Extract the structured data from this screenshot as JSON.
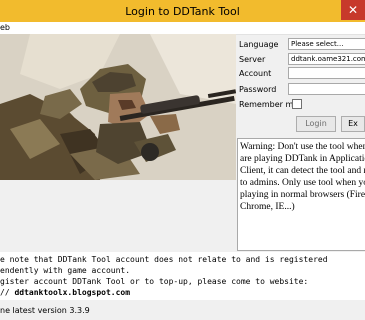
{
  "window": {
    "title": "Login to DDTank Tool",
    "close_glyph": "✕"
  },
  "menu": {
    "item": "eb"
  },
  "form": {
    "language_label": "Language",
    "language_value": "Please select...",
    "server_label": "Server",
    "server_value": "ddtank.oame321.com",
    "account_label": "Account",
    "account_value": "",
    "password_label": "Password",
    "password_value": "",
    "remember_label": "Remember me",
    "login_button": "Login",
    "exit_button": "Ex"
  },
  "warning": {
    "text": "Warning: Don't use the tool when you are playing DDTank in Application Client, it can detect the tool and report to admins. Only use tool when you are playing in normal browsers (Firefox, Chrome, IE...)"
  },
  "notice": {
    "line1": "e note that DDTank Tool account does not relate to and is registered",
    "line2": "endently with game account.",
    "line3": "gister account DDTank Tool or to top-up, please come to website:",
    "line4_prefix": "// ",
    "line4_url": "ddtanktoolx.blogspot.com"
  },
  "status": {
    "version": "ne latest version 3.3.9"
  },
  "colors": {
    "titlebar": "#f2bb2d",
    "close": "#c7392b"
  }
}
